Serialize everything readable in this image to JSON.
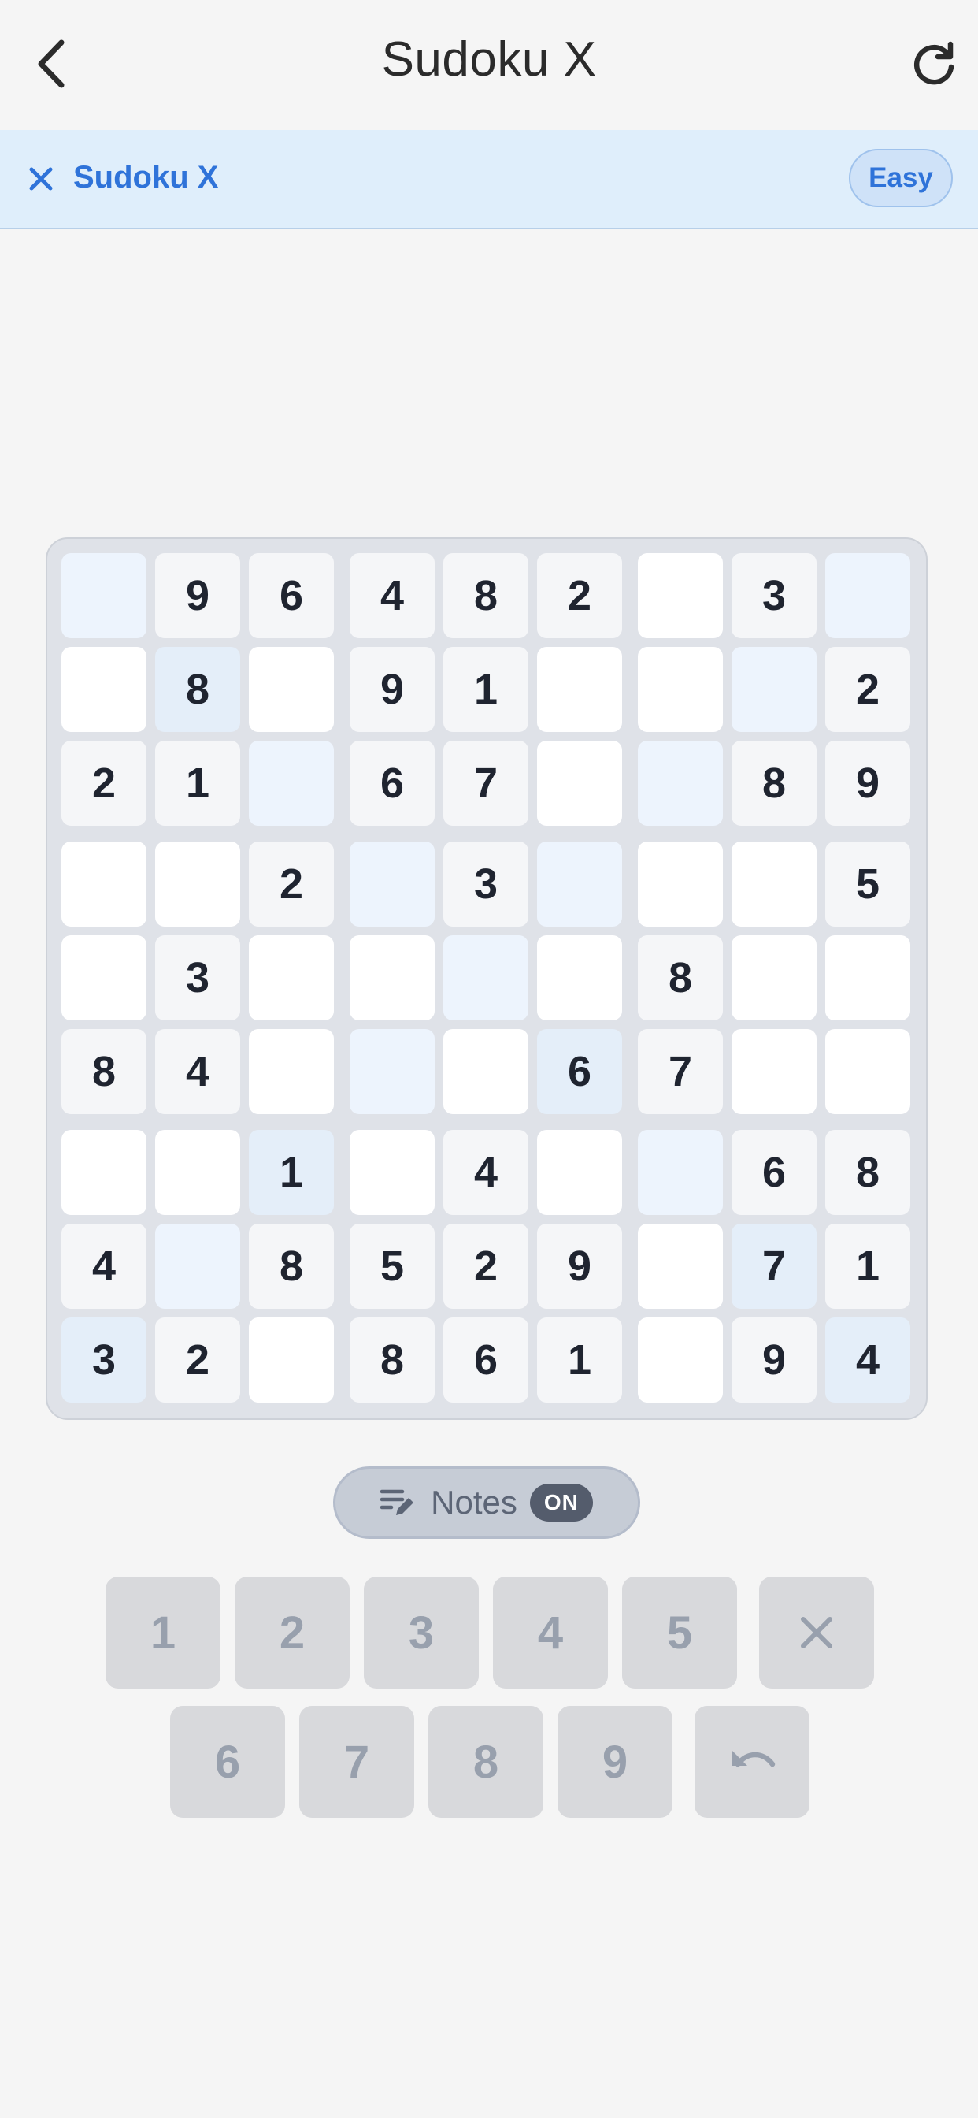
{
  "header": {
    "title": "Sudoku X",
    "back_icon": "chevron-left-icon",
    "refresh_icon": "refresh-icon"
  },
  "banner": {
    "close_icon": "close-icon",
    "title": "Sudoku X",
    "difficulty": "Easy"
  },
  "board": {
    "rows": [
      [
        "",
        "9",
        "6",
        "4",
        "8",
        "2",
        "",
        "3",
        ""
      ],
      [
        "",
        "8",
        "",
        "9",
        "1",
        "",
        "",
        "",
        "2"
      ],
      [
        "2",
        "1",
        "",
        "6",
        "7",
        "",
        "",
        "8",
        "9"
      ],
      [
        "",
        "",
        "2",
        "",
        "3",
        "",
        "",
        "",
        "5"
      ],
      [
        "",
        "3",
        "",
        "",
        "",
        "",
        "8",
        "",
        ""
      ],
      [
        "8",
        "4",
        "",
        "",
        "",
        "6",
        "7",
        "",
        ""
      ],
      [
        "",
        "",
        "1",
        "",
        "4",
        "",
        "",
        "6",
        "8"
      ],
      [
        "4",
        "",
        "8",
        "5",
        "2",
        "9",
        "",
        "7",
        "1"
      ],
      [
        "3",
        "2",
        "",
        "8",
        "6",
        "1",
        "",
        "9",
        "4"
      ]
    ]
  },
  "notes": {
    "label": "Notes",
    "state": "ON",
    "icon": "notes-edit-icon"
  },
  "keypad": {
    "row1": [
      "1",
      "2",
      "3",
      "4",
      "5"
    ],
    "row2": [
      "6",
      "7",
      "8",
      "9"
    ],
    "erase_icon": "close-icon",
    "undo_icon": "undo-icon"
  },
  "colors": {
    "accent": "#2f73d9",
    "banner_bg": "#dfeefb",
    "board_bg": "#dfe2e8",
    "key_bg": "#d8d9dc"
  }
}
